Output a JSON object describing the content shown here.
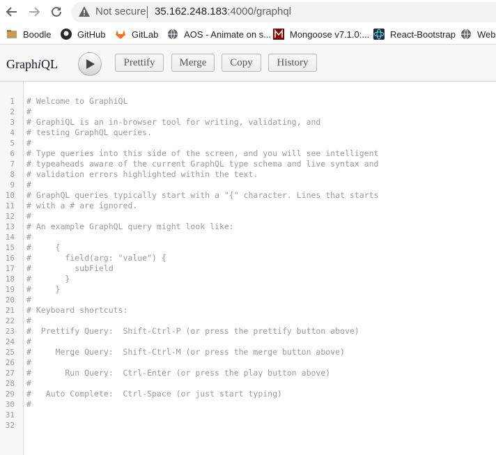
{
  "browser": {
    "security_label": "Not secure",
    "url_host": "35.162.248.183",
    "url_rest": ":4000/graphql",
    "bookmarks": [
      {
        "label": "Boodle",
        "icon": "folder-icon"
      },
      {
        "label": "GitHub",
        "icon": "github-icon"
      },
      {
        "label": "GitLab",
        "icon": "gitlab-icon"
      },
      {
        "label": "AOS - Animate on s...",
        "icon": "globe-icon"
      },
      {
        "label": "Mongoose v7.1.0:...",
        "icon": "mongoose-icon"
      },
      {
        "label": "React-Bootstrap",
        "icon": "react-bootstrap-icon"
      },
      {
        "label": "Web",
        "icon": "globe-icon"
      }
    ]
  },
  "toolbar": {
    "title_prefix": "Graph",
    "title_italic": "i",
    "title_suffix": "QL",
    "buttons": {
      "prettify": "Prettify",
      "merge": "Merge",
      "copy": "Copy",
      "history": "History"
    }
  },
  "editor": {
    "line_numbers": [
      "1",
      "2",
      "3",
      "4",
      "5",
      "6",
      "7",
      "8",
      "9",
      "10",
      "11",
      "12",
      "13",
      "14",
      "15",
      "16",
      "17",
      "18",
      "19",
      "20",
      "21",
      "22",
      "23",
      "24",
      "25",
      "26",
      "27",
      "28",
      "29",
      "30",
      "31",
      "32"
    ],
    "lines": [
      "# Welcome to GraphiQL",
      "#",
      "# GraphiQL is an in-browser tool for writing, validating, and",
      "# testing GraphQL queries.",
      "#",
      "# Type queries into this side of the screen, and you will see intelligent",
      "# typeaheads aware of the current GraphQL type schema and live syntax and",
      "# validation errors highlighted within the text.",
      "#",
      "# GraphQL queries typically start with a \"{\" character. Lines that starts",
      "# with a # are ignored.",
      "#",
      "# An example GraphQL query might look like:",
      "#",
      "#     {",
      "#       field(arg: \"value\") {",
      "#         subField",
      "#       }",
      "#     }",
      "#",
      "# Keyboard shortcuts:",
      "#",
      "#  Prettify Query:  Shift-Ctrl-P (or press the prettify button above)",
      "#",
      "#     Merge Query:  Shift-Ctrl-M (or press the merge button above)",
      "#",
      "#       Run Query:  Ctrl-Enter (or press the play button above)",
      "#",
      "#   Auto Complete:  Ctrl-Space (or just start typing)",
      "#",
      "",
      ""
    ]
  }
}
